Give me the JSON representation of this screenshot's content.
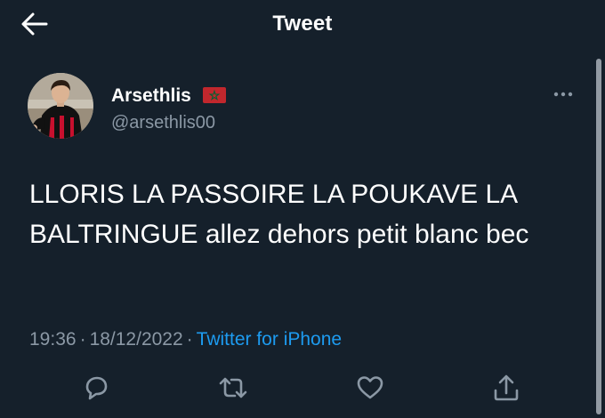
{
  "header": {
    "title": "Tweet",
    "back_icon": "arrow-left-icon"
  },
  "author": {
    "display_name": "Arsethlis",
    "flag_icon": "morocco-flag-icon",
    "handle": "@arsethlis00",
    "avatar": "avatar"
  },
  "tweet": {
    "text": "LLORIS LA PASSOIRE LA POUKAVE LA BALTRINGUE allez dehors petit blanc bec",
    "time": "19:36",
    "date": "18/12/2022",
    "separator": "·",
    "source": "Twitter for iPhone"
  },
  "actions": [
    {
      "name": "reply",
      "icon": "reply-icon"
    },
    {
      "name": "retweet",
      "icon": "retweet-icon"
    },
    {
      "name": "like",
      "icon": "heart-icon"
    },
    {
      "name": "share",
      "icon": "share-icon"
    }
  ],
  "colors": {
    "background": "#15202b",
    "text": "#ffffff",
    "secondary": "#8b98a5",
    "accent": "#1d9bf0",
    "flag_red": "#c1272d",
    "flag_green": "#006233"
  }
}
